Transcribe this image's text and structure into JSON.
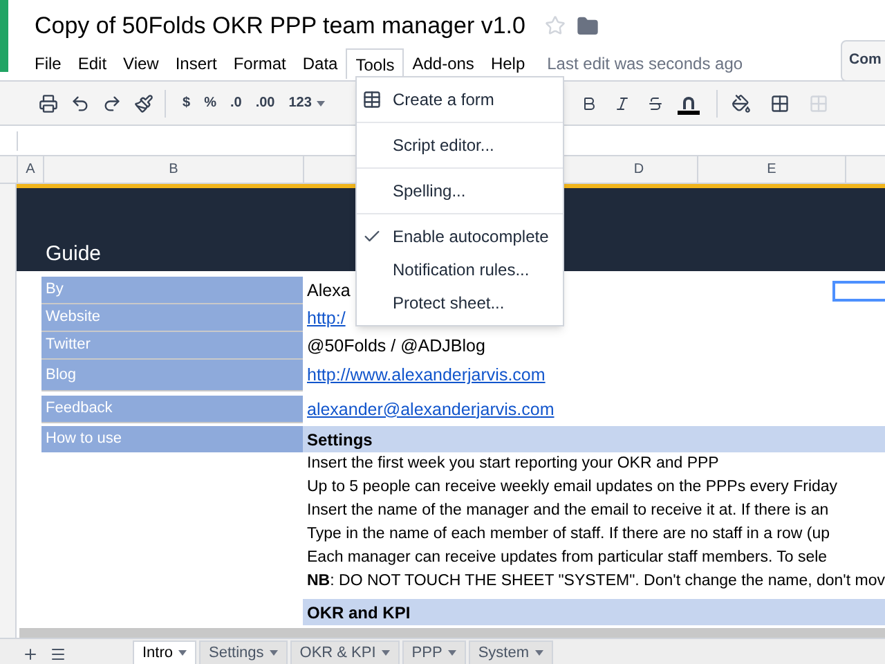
{
  "document": {
    "title": "Copy of 50Folds OKR PPP team manager v1.0",
    "status": "Last edit was seconds ago",
    "share_button": "Com"
  },
  "menu_bar": [
    {
      "label": "File",
      "selected": false
    },
    {
      "label": "Edit",
      "selected": false
    },
    {
      "label": "View",
      "selected": false
    },
    {
      "label": "Insert",
      "selected": false
    },
    {
      "label": "Format",
      "selected": false
    },
    {
      "label": "Data",
      "selected": false
    },
    {
      "label": "Tools",
      "selected": true
    },
    {
      "label": "Add-ons",
      "selected": false
    },
    {
      "label": "Help",
      "selected": false
    }
  ],
  "toolbar": {
    "format_labels": [
      "$",
      "%",
      ".0",
      ".00",
      "123"
    ]
  },
  "column_headers": [
    "A",
    "B",
    "D",
    "E"
  ],
  "tools_menu": [
    {
      "label": "Create a form",
      "kind": "form",
      "checked": false,
      "group_end": true
    },
    {
      "label": "Script editor...",
      "kind": "plain",
      "checked": false,
      "group_end": true
    },
    {
      "label": "Spelling...",
      "kind": "plain",
      "checked": false,
      "group_end": true
    },
    {
      "label": "Enable autocomplete",
      "kind": "plain",
      "checked": true,
      "group_end": false
    },
    {
      "label": "Notification rules...",
      "kind": "plain",
      "checked": false,
      "group_end": false
    },
    {
      "label": "Protect sheet...",
      "kind": "plain",
      "checked": false,
      "group_end": false
    }
  ],
  "sheet": {
    "heading": "Guide",
    "info_rows": [
      {
        "label": "By",
        "value": "Alexa",
        "kind": "text"
      },
      {
        "label": "Website",
        "value": "http:/",
        "kind": "link"
      },
      {
        "label": "Twitter",
        "value": "@50Folds / @ADJBlog",
        "kind": "text"
      },
      {
        "label": "Blog",
        "value": "http://www.alexanderjarvis.com",
        "kind": "link"
      },
      {
        "label": "Feedback",
        "value": "alexander@alexanderjarvis.com",
        "kind": "link"
      }
    ],
    "how_to_label": "How to use",
    "sections": [
      {
        "title": "Settings",
        "lines": [
          "Insert the first week you start reporting your OKR and PPP",
          "Up to 5 people can receive weekly email updates on the PPPs every Friday",
          "Insert the name of the manager and the email to receive it at. If there is an",
          "Type in the name of each member of staff. If there are no staff in a row (up",
          "Each manager can receive updates from particular staff members. To sele",
          "**NB**: DO NOT TOUCH THE SHEET \"SYSTEM\". Don't change the name, don't mov"
        ]
      },
      {
        "title": "OKR and KPI"
      }
    ]
  },
  "sheet_tabs": [
    {
      "label": "Intro",
      "selected": true
    },
    {
      "label": "Settings",
      "selected": false
    },
    {
      "label": "OKR & KPI",
      "selected": false
    },
    {
      "label": "PPP",
      "selected": false
    },
    {
      "label": "System",
      "selected": false
    }
  ]
}
